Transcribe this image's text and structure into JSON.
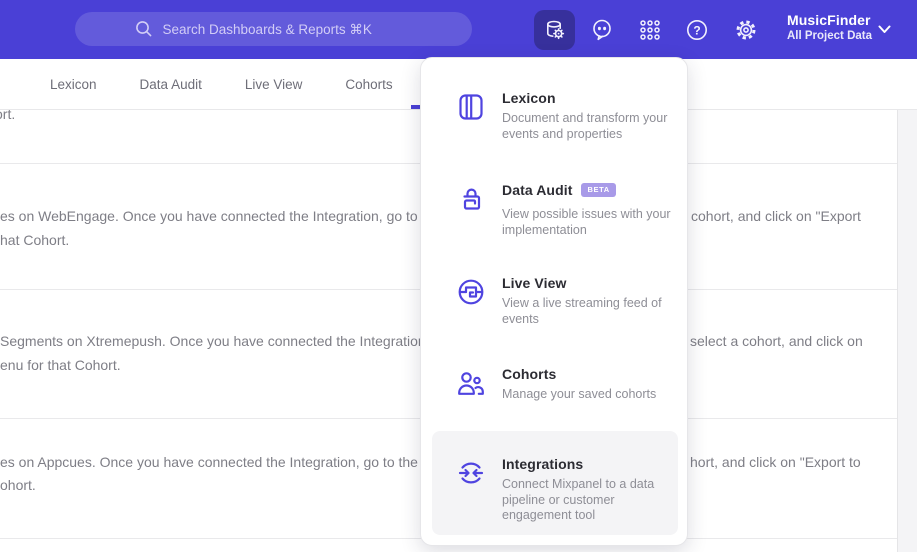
{
  "topbar": {
    "search": {
      "placeholder": "Search Dashboards & Reports ⌘K",
      "icon": "search-icon"
    },
    "icons": [
      "data-management-icon",
      "feedback-icon",
      "apps-grid-icon",
      "help-icon",
      "settings-icon",
      "chevron-down-icon"
    ],
    "help_glyph": "?",
    "project": {
      "name": "MusicFinder",
      "scope": "All Project Data"
    }
  },
  "tabs": [
    {
      "label": "Lexicon"
    },
    {
      "label": "Data Audit"
    },
    {
      "label": "Live View"
    },
    {
      "label": "Cohorts"
    }
  ],
  "menu": {
    "items": [
      {
        "title": "Lexicon",
        "desc": "Document and transform your events and properties",
        "icon": "lexicon-icon",
        "highlighted": false
      },
      {
        "title": "Data Audit",
        "badge": "BETA",
        "desc": "View possible issues with your implementation",
        "icon": "data-audit-icon",
        "highlighted": false
      },
      {
        "title": "Live View",
        "desc": "View a live streaming feed of events",
        "icon": "live-view-icon",
        "highlighted": false
      },
      {
        "title": "Cohorts",
        "desc": "Manage your saved cohorts",
        "icon": "cohorts-icon",
        "highlighted": false
      },
      {
        "title": "Integrations",
        "desc": "Connect Mixpanel to a data pipeline or customer engagement tool",
        "icon": "integrations-icon",
        "highlighted": true
      }
    ]
  },
  "background": {
    "rows": [
      {
        "fragment": "ort."
      },
      {
        "line1_left": "es on WebEngage. Once you have connected the Integration, go to the",
        "line1_right": "cohort, and click on \"Export",
        "line2": "hat Cohort."
      },
      {
        "line1_left": "Segments on Xtremepush. Once you have connected the Integration,",
        "line1_right": "select a cohort, and click on",
        "line2": "enu for that Cohort."
      },
      {
        "line1_left": "es on Appcues. Once you have connected the Integration, go to the M",
        "line1_right": "hort, and click on \"Export to",
        "line2": "ohort."
      }
    ]
  },
  "colors": {
    "accent_purple": "#4a40d6",
    "icon_purple": "#4f44e0",
    "selected_btn_bg": "#37309c",
    "badge_bg": "#a89ae8",
    "highlight_bg": "#f4f4f6",
    "text_dark": "#2c2c33",
    "text_gray": "#8e8e96"
  }
}
